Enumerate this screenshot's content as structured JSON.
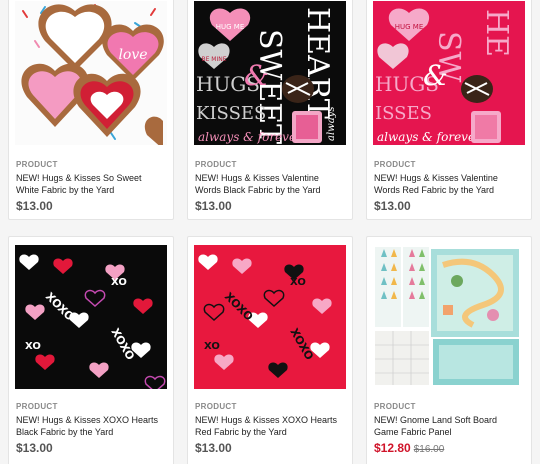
{
  "products": [
    {
      "label": "PRODUCT",
      "title_line1": "NEW! Hugs & Kisses So Sweet",
      "title_line2": "White Fabric by the Yard",
      "price": "$13.00",
      "image_icon": "heart-cookies-fabric-image"
    },
    {
      "label": "PRODUCT",
      "title_line1": "NEW! Hugs & Kisses Valentine",
      "title_line2": "Words Black Fabric by the Yard",
      "price": "$13.00",
      "image_icon": "valentine-words-black-fabric-image",
      "image_words": [
        "HUGS",
        "&",
        "KISSES",
        "SWEET",
        "HEART",
        "always & forever",
        "HUG ME",
        "BE MINE"
      ]
    },
    {
      "label": "PRODUCT",
      "title_line1": "NEW! Hugs & Kisses Valentine",
      "title_line2": "Words Red Fabric by the Yard",
      "price": "$13.00",
      "image_icon": "valentine-words-red-fabric-image",
      "image_words": [
        "HUGS",
        "&",
        "always & forever",
        "HUG ME"
      ]
    },
    {
      "label": "PRODUCT",
      "title_line1": "NEW! Hugs & Kisses XOXO Hearts",
      "title_line2": "Black Fabric by the Yard",
      "price": "$13.00",
      "image_icon": "xoxo-hearts-black-fabric-image",
      "image_words": [
        "XO",
        "XOXO"
      ]
    },
    {
      "label": "PRODUCT",
      "title_line1": "NEW! Hugs & Kisses XOXO Hearts",
      "title_line2": "Red Fabric by the Yard",
      "price": "$13.00",
      "image_icon": "xoxo-hearts-red-fabric-image",
      "image_words": [
        "XO",
        "XOXO"
      ]
    },
    {
      "label": "PRODUCT",
      "title_line1": "NEW! Gnome Land Soft Board",
      "title_line2": "Game Fabric Panel",
      "price": "$12.80",
      "old_price": "$16.00",
      "image_icon": "gnome-board-game-panel-image"
    }
  ],
  "colors": {
    "sale": "#d0142a",
    "label": "#8a8a8a",
    "price": "#555555"
  }
}
